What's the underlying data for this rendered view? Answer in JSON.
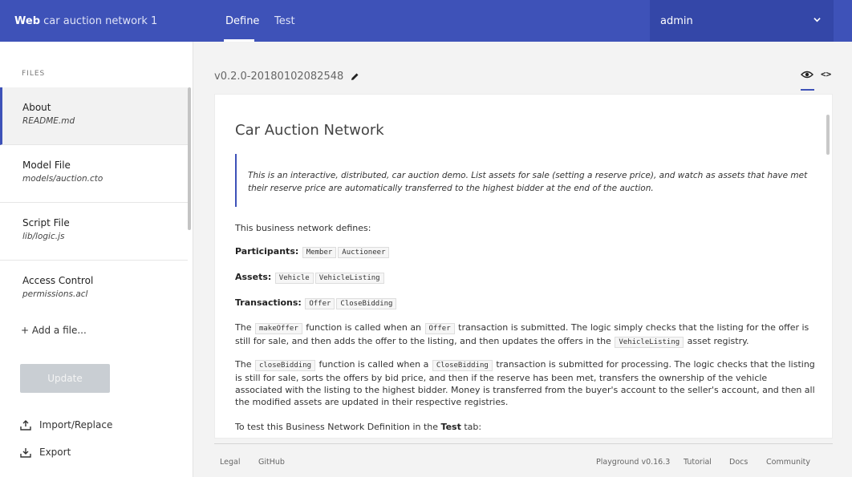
{
  "header": {
    "brand_bold": "Web",
    "brand_rest": "car auction network 1",
    "tabs": [
      {
        "label": "Define",
        "active": true
      },
      {
        "label": "Test",
        "active": false
      }
    ],
    "user": "admin",
    "accent_color": "#3e52b8"
  },
  "sidebar": {
    "heading": "FILES",
    "files": [
      {
        "title": "About",
        "path": "README.md",
        "active": true
      },
      {
        "title": "Model File",
        "path": "models/auction.cto"
      },
      {
        "title": "Script File",
        "path": "lib/logic.js"
      },
      {
        "title": "Access Control",
        "path": "permissions.acl"
      }
    ],
    "add_file": "+ Add a file...",
    "update_label": "Update",
    "import_label": "Import/Replace",
    "export_label": "Export"
  },
  "main": {
    "version": "v0.2.0-20180102082548",
    "doc": {
      "title": "Car Auction Network",
      "quote": "This is an interactive, distributed, car auction demo. List assets for sale (setting a reserve price), and watch as assets that have met their reserve price are automatically transferred to the highest bidder at the end of the auction.",
      "intro": "This business network defines:",
      "participants_label": "Participants:",
      "participants": [
        "Member",
        "Auctioneer"
      ],
      "assets_label": "Assets:",
      "assets": [
        "Vehicle",
        "VehicleListing"
      ],
      "transactions_label": "Transactions:",
      "transactions": [
        "Offer",
        "CloseBidding"
      ],
      "p1_a": "The",
      "p1_code1": "makeOffer",
      "p1_b": "function is called when an",
      "p1_code2": "Offer",
      "p1_c": "transaction is submitted. The logic simply checks that the listing for the offer is still for sale, and then adds the offer to the listing, and then updates the offers in the",
      "p1_code3": "VehicleListing",
      "p1_d": "asset registry.",
      "p2_a": "The",
      "p2_code1": "closeBidding",
      "p2_b": "function is called when a",
      "p2_code2": "CloseBidding",
      "p2_c": "transaction is submitted for processing. The logic checks that the listing is still for sale, sorts the offers by bid price, and then if the reserve has been met, transfers the ownership of the vehicle associated with the listing to the highest bidder. Money is transferred from the buyer's account to the seller's account, and then all the modified assets are updated in their respective registries.",
      "p3_a": "To test this Business Network Definition in the",
      "p3_b": "Test",
      "p3_c": "tab:"
    }
  },
  "footer": {
    "legal": "Legal",
    "github": "GitHub",
    "version": "Playground v0.16.3",
    "tutorial": "Tutorial",
    "docs": "Docs",
    "community": "Community"
  }
}
